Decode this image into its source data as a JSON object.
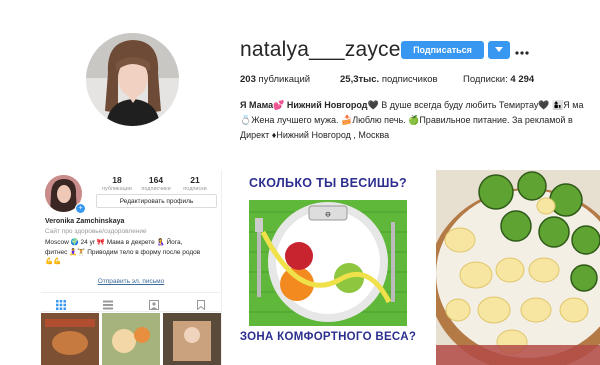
{
  "profile": {
    "username": "natalya___zayceva",
    "follow_label": "Подписаться",
    "stats": {
      "posts_count": "203",
      "posts_label": "публикаций",
      "followers_count": "25,3тыс.",
      "followers_label": "подписчиков",
      "following_label": "Подписки:",
      "following_count": "4 294"
    },
    "bio": {
      "line1_bold": "Я Мама💕 Нижний Новгород🖤",
      "line1_rest": " В душе всегда буду любить Темиртау🖤 👩‍👦Я ма",
      "line2": "💍Жена лучшего мужа. 🍰Люблю печь. 🍏Правильное питание. За рекламой в",
      "line3": "Директ ♦Нижний Новгород , Москва"
    }
  },
  "phone": {
    "posts_count": "18",
    "posts_label": "публикации",
    "followers_count": "164",
    "followers_label": "подписчики",
    "following_count": "21",
    "following_label": "подписки",
    "edit_label": "Редактировать профиль",
    "name": "Veronika Zamchinskaya",
    "subtitle": "Сайт про здоровье/оздоровление",
    "bio1": "Moscow 🌍 24 yr 🎀 Мама в декрете 🤱 Йога,",
    "bio2": "фитнес 🧘‍♀️🏋 Приводим тело в форму после родов",
    "bio3": "💪💪",
    "link": "Отправить эл. письмо"
  },
  "weight_post": {
    "title": "СКОЛЬКО ТЫ ВЕСИШЬ?",
    "bottom": "ЗОНА КОМФОРТНОГО ВЕСА?"
  },
  "icons": {
    "dropdown": "chevron-down-icon",
    "more": "more-dots-icon",
    "grid": "grid-icon",
    "list": "list-icon",
    "tagged": "tagged-icon",
    "saved": "bookmark-icon"
  },
  "colors": {
    "accent": "#3897f0",
    "poster_text": "#2d2f8f",
    "poster_green": "#5fb83a"
  }
}
